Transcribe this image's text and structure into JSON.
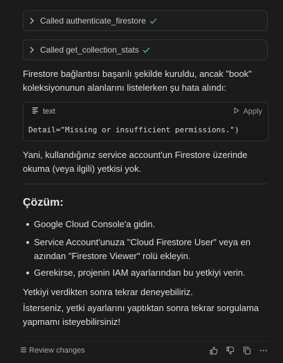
{
  "tool_calls": [
    {
      "label": "Called authenticate_firestore",
      "status_icon": "check-icon"
    },
    {
      "label": "Called get_collection_stats",
      "status_icon": "check-icon"
    }
  ],
  "message": {
    "intro_line1": "Firestore bağlantısı başarılı şekilde kuruldu, ancak \"book\"",
    "intro_line2": "koleksiyonunun alanlarını listelerken şu hata alındı:",
    "code_block": {
      "language": "text",
      "apply_label": "Apply",
      "code": "Detail=\"Missing or insufficient permissions.\")"
    },
    "explain_line1": "Yani, kullandığınız service account'un Firestore üzerinde",
    "explain_line2": "okuma (veya ilgili) yetkisi yok.",
    "heading": "Çözüm:",
    "bullets": [
      {
        "line1": "Google Cloud Console'a gidin.",
        "line2": ""
      },
      {
        "line1": "Service Account'unuza \"Cloud Firestore User\" veya en",
        "line2": "azından \"Firestore Viewer\" rolü ekleyin."
      },
      {
        "line1": "Gerekirse, projenin IAM ayarlarından bu yetkiyi verin.",
        "line2": ""
      }
    ],
    "retry_text": "Yetkiyi verdikten sonra tekrar deneyebiliriz.",
    "closing_line1": "İsterseniz, yetki ayarlarını yaptıktan sonra tekrar sorgulama",
    "closing_line2": "yapmamı isteyebilirsiniz!"
  },
  "footer": {
    "review_label": "Review changes",
    "actions": [
      "thumbs-up-icon",
      "thumbs-down-icon",
      "copy-icon",
      "more-icon"
    ]
  },
  "colors": {
    "background": "#1b1b1b",
    "check": "#5fb37a",
    "text": "#dedede"
  }
}
